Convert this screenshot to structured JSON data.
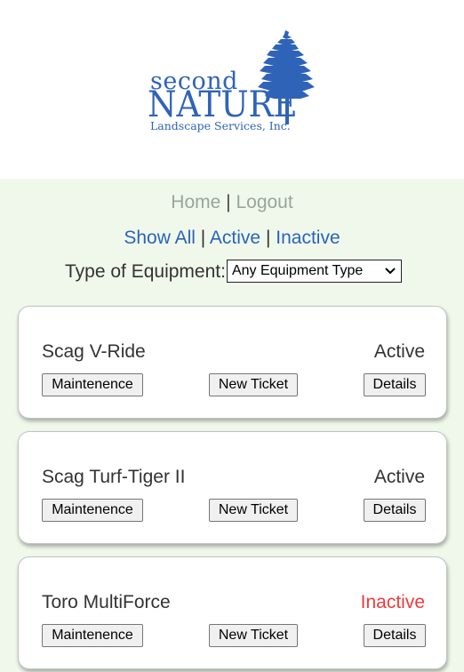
{
  "logo": {
    "line1": "second",
    "line2": "NATURE",
    "line3": "Landscape Services, Inc.",
    "icon": "pine-tree-icon",
    "color": "#2f63b8"
  },
  "nav": {
    "home": "Home",
    "separator": "|",
    "logout": "Logout"
  },
  "filters": {
    "show_all": "Show All",
    "active": "Active",
    "inactive": "Inactive",
    "separator": "|"
  },
  "equipment_type": {
    "label": "Type of Equipment:",
    "selected": "Any Equipment Type"
  },
  "buttons": {
    "maintenance": "Maintenence",
    "new_ticket": "New Ticket",
    "details": "Details"
  },
  "equipment": [
    {
      "name": "Scag V-Ride",
      "status": "Active"
    },
    {
      "name": "Scag Turf-Tiger II",
      "status": "Active"
    },
    {
      "name": "Toro MultiForce",
      "status": "Inactive"
    }
  ],
  "colors": {
    "background": "#f0f8ec",
    "link": "#2b64b6",
    "muted_link": "#9aa59a",
    "inactive": "#ee3b3b"
  }
}
